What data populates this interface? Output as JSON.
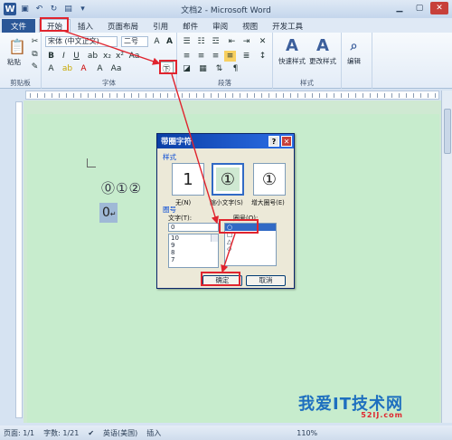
{
  "window": {
    "title": "文档2 - Microsoft Word"
  },
  "tabs": [
    {
      "label": "文件"
    },
    {
      "label": "开始"
    },
    {
      "label": "插入"
    },
    {
      "label": "页面布局"
    },
    {
      "label": "引用"
    },
    {
      "label": "邮件"
    },
    {
      "label": "审阅"
    },
    {
      "label": "视图"
    },
    {
      "label": "开发工具"
    }
  ],
  "ribbon": {
    "paste_label": "粘贴",
    "clipboard_group": "剪贴板",
    "font_name": "宋体 (中文正文)",
    "font_size": "二号",
    "font_group": "字体",
    "paragraph_group": "段落",
    "quick_styles": "快速样式",
    "change_styles": "更改样式",
    "styles_group": "样式",
    "edit": "编辑",
    "enclose_char_glyph": "㊦"
  },
  "document": {
    "circled_numbers": "⓪①②",
    "selected_text": "0",
    "paragraph_mark": "↵"
  },
  "dialog": {
    "title": "带圈字符",
    "style_section": "样式",
    "styles": [
      {
        "glyph": "1",
        "label": "无(N)"
      },
      {
        "glyph": "①",
        "label": "缩小文字(S)"
      },
      {
        "glyph": "①",
        "label": "增大圈号(E)"
      }
    ],
    "enclosure_section": "圈号",
    "text_label": "文字(T):",
    "text_value": "0",
    "text_list": [
      "10",
      "9",
      "8",
      "7"
    ],
    "shape_label": "圈号(O):",
    "shapes": [
      "○",
      "□",
      "△",
      "◇"
    ],
    "ok": "确定",
    "cancel": "取消"
  },
  "statusbar": {
    "page": "页面: 1/1",
    "words": "字数: 1/21",
    "language": "英语(美国)",
    "mode": "插入",
    "zoom": "110%"
  },
  "watermark": {
    "text": "我爱IT技术网",
    "sub": "52IJ.com"
  }
}
